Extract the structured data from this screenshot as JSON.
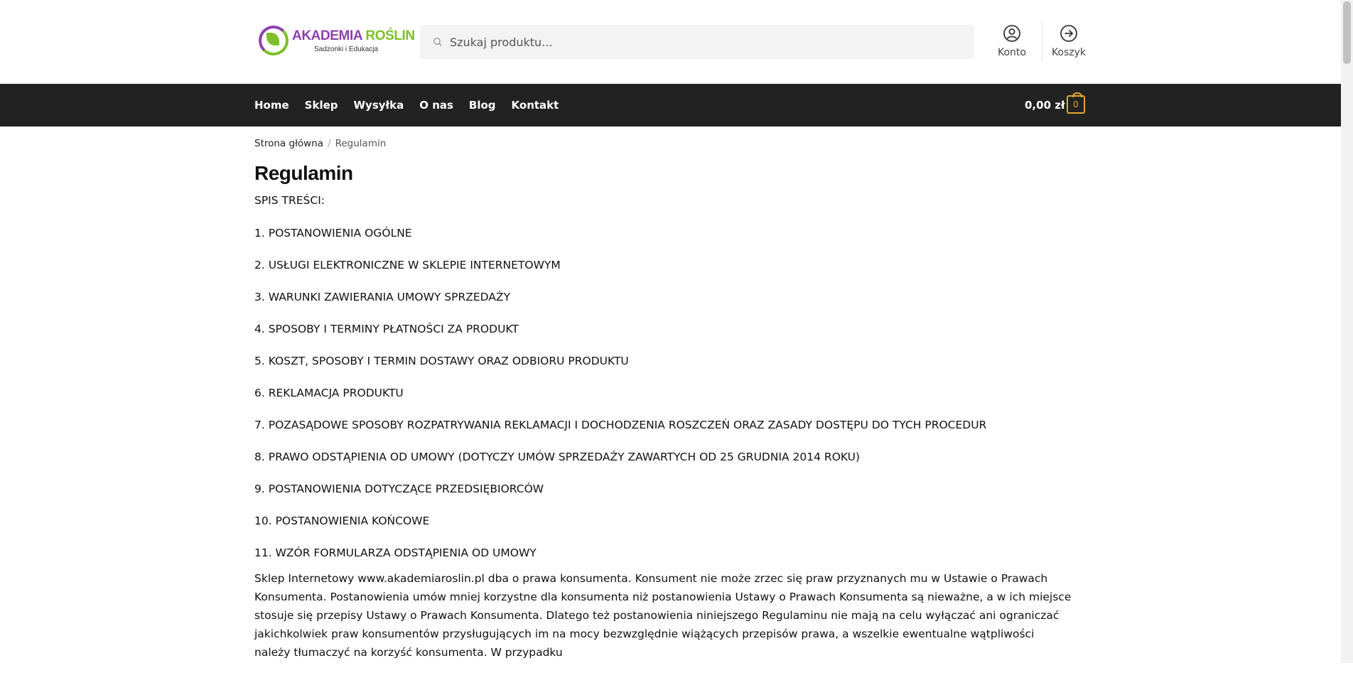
{
  "header": {
    "logo_brand_part1": "AKADEMIA",
    "logo_brand_part2": "ROŚLIN",
    "logo_tagline": "Sadzonki i Edukacja",
    "search_placeholder": "Szukaj produktu...",
    "account_label": "Konto",
    "cart_label": "Koszyk"
  },
  "nav": {
    "items": [
      "Home",
      "Sklep",
      "Wysyłka",
      "O nas",
      "Blog",
      "Kontakt"
    ],
    "cart_total": "0,00 zł",
    "cart_count": "0"
  },
  "breadcrumb": {
    "home": "Strona główna",
    "separator": "/",
    "current": "Regulamin"
  },
  "page": {
    "title": "Regulamin",
    "toc": [
      "SPIS TREŚCI:",
      "1. POSTANOWIENIA OGÓLNE",
      "2. USŁUGI ELEKTRONICZNE W SKLEPIE INTERNETOWYM",
      "3. WARUNKI ZAWIERANIA UMOWY SPRZEDAŻY",
      "4. SPOSOBY I TERMINY PŁATNOŚCI ZA PRODUKT",
      "5. KOSZT, SPOSOBY I TERMIN DOSTAWY ORAZ ODBIORU PRODUKTU",
      "6. REKLAMACJA PRODUKTU",
      "7. POZASĄDOWE SPOSOBY ROZPATRYWANIA REKLAMACJI I DOCHODZENIA ROSZCZEŃ ORAZ ZASADY DOSTĘPU DO TYCH PROCEDUR",
      "8. PRAWO ODSTĄPIENIA OD UMOWY (DOTYCZY UMÓW SPRZEDAŻY ZAWARTYCH OD 25 GRUDNIA 2014 ROKU)",
      "9. POSTANOWIENIA DOTYCZĄCE PRZEDSIĘBIORCÓW",
      "10. POSTANOWIENIA KOŃCOWE",
      "11. WZÓR FORMULARZA ODSTĄPIENIA OD UMOWY"
    ],
    "intro_paragraph": "Sklep Internetowy www.akademiaroslin.pl dba o prawa konsumenta. Konsument nie może zrzec się praw przyznanych mu w Ustawie o Prawach Konsumenta. Postanowienia umów mniej korzystne dla konsumenta niż postanowienia Ustawy o Prawach Konsumenta są nieważne, a w ich miejsce stosuje się przepisy Ustawy o Prawach Konsumenta. Dlatego też postanowienia niniejszego Regulaminu nie mają na celu wyłączać ani ograniczać jakichkolwiek praw konsumentów przysługujących im na mocy bezwzględnie wiążących przepisów prawa, a wszelkie ewentualne wątpliwości należy tłumaczyć na korzyść konsumenta. W przypadku"
  },
  "colors": {
    "nav_bg": "#222222",
    "logo_purple": "#8e3fb0",
    "logo_green": "#7cbf2a",
    "cart_accent": "#e2a72e"
  }
}
